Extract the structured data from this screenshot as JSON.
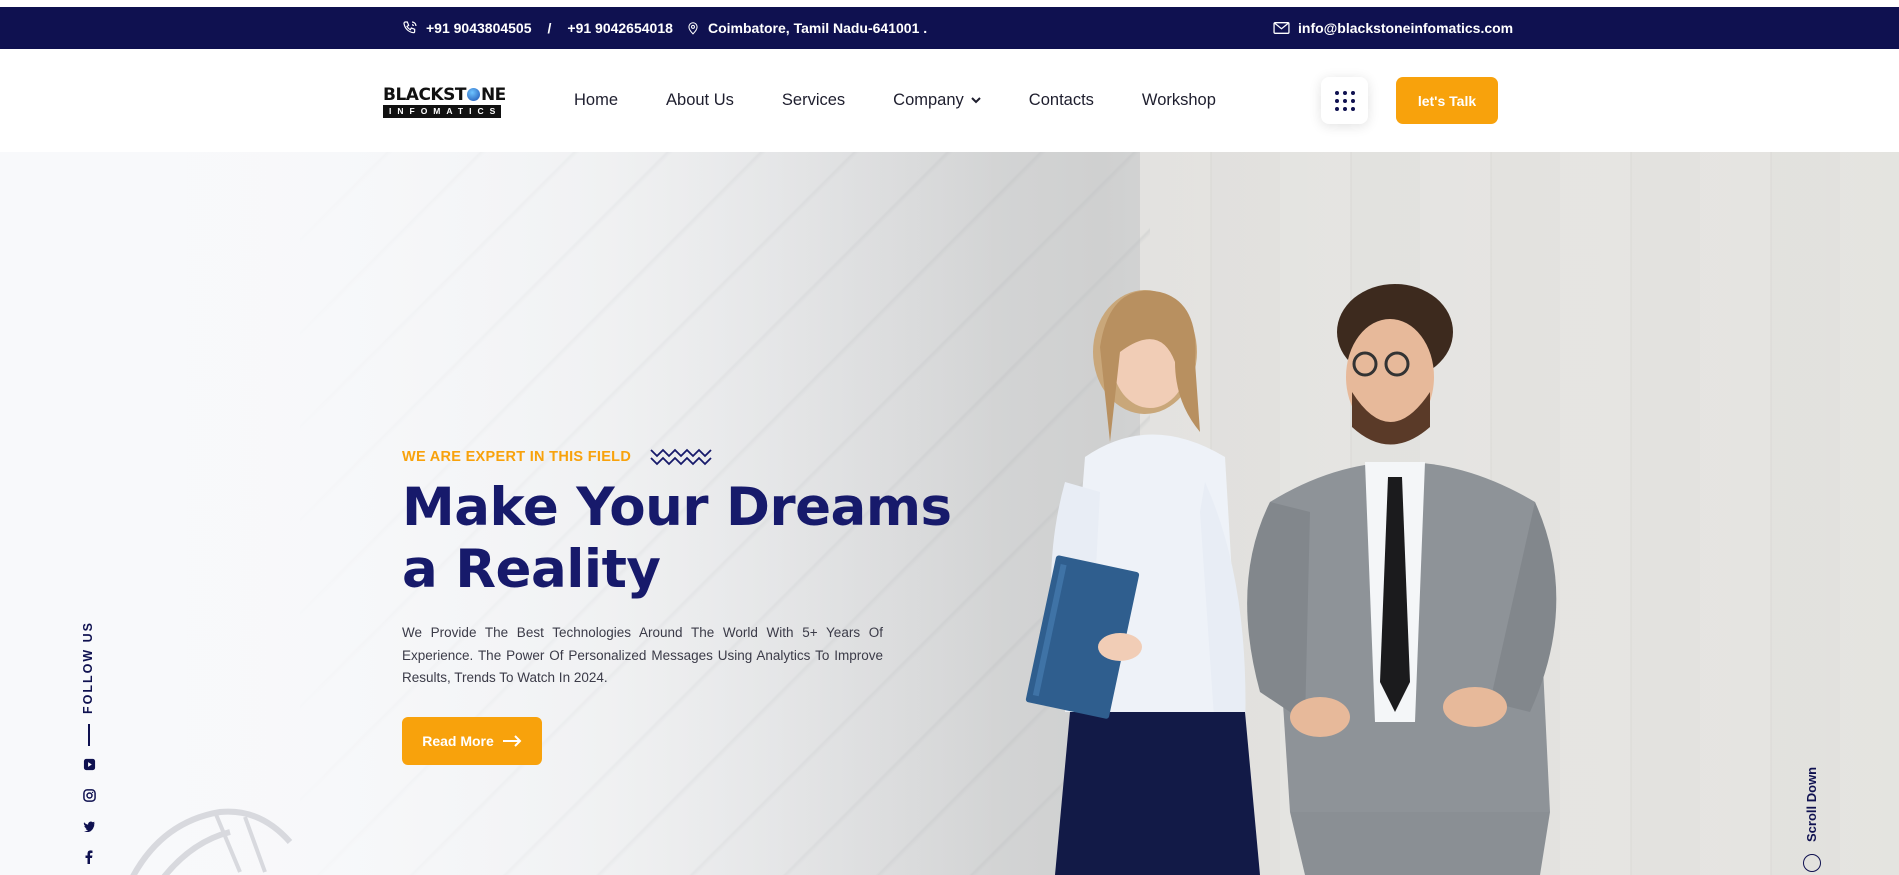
{
  "topbar": {
    "phone1": "+91 9043804505",
    "separator": "/",
    "phone2": "+91 9042654018",
    "address": "Coimbatore, Tamil Nadu-641001 .",
    "email": "info@blackstoneinfomatics.com"
  },
  "header": {
    "logo_line1_a": "BLACKST",
    "logo_line1_b": "NE",
    "logo_line2": "INFOMATICS",
    "nav": {
      "home": "Home",
      "about": "About Us",
      "services": "Services",
      "company": "Company",
      "contacts": "Contacts",
      "workshop": "Workshop"
    },
    "cta_label": "let's Talk"
  },
  "hero": {
    "follow_label": "FOLLOW US",
    "kicker": "WE ARE EXPERT IN THIS FIELD",
    "headline_line1": "Make Your Dreams",
    "headline_line2": "a Reality",
    "description": "We Provide The Best Technologies Around The World With 5+ Years Of Experience. The Power Of Personalized Messages Using Analytics To Improve Results, Trends To Watch In 2024.",
    "read_more": "Read More",
    "scroll_down": "Scroll Down"
  },
  "icons": [
    "phone-icon",
    "location-icon",
    "mail-icon",
    "chevron-down-icon",
    "grid-menu-icon",
    "arrow-right-icon",
    "youtube-icon",
    "instagram-icon",
    "twitter-icon",
    "facebook-icon"
  ],
  "colors": {
    "navy": "#0f1150",
    "accent": "#f8a20c",
    "headline": "#171a6b"
  }
}
